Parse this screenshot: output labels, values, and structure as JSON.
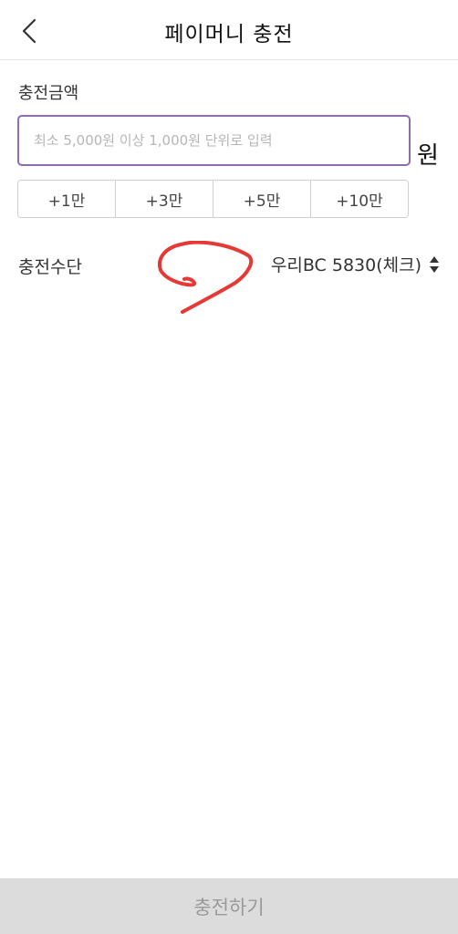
{
  "header": {
    "title": "페이머니 충전",
    "back_icon": "chevron-left-icon"
  },
  "amount": {
    "label": "충전금액",
    "placeholder": "최소 5,000원 이상 1,000원 단위로 입력",
    "value": "",
    "unit": "원",
    "accent_color": "#8f6bb0"
  },
  "presets": [
    {
      "label": "+1만"
    },
    {
      "label": "+3만"
    },
    {
      "label": "+5만"
    },
    {
      "label": "+10만"
    }
  ],
  "payment_method": {
    "label": "충전수단",
    "selected": "우리BC 5830(체크)",
    "icon": "sort-arrows-icon"
  },
  "annotation": {
    "color": "#e53935",
    "icon": "red-scribble-annotation"
  },
  "submit": {
    "label": "충전하기",
    "state": "disabled"
  }
}
